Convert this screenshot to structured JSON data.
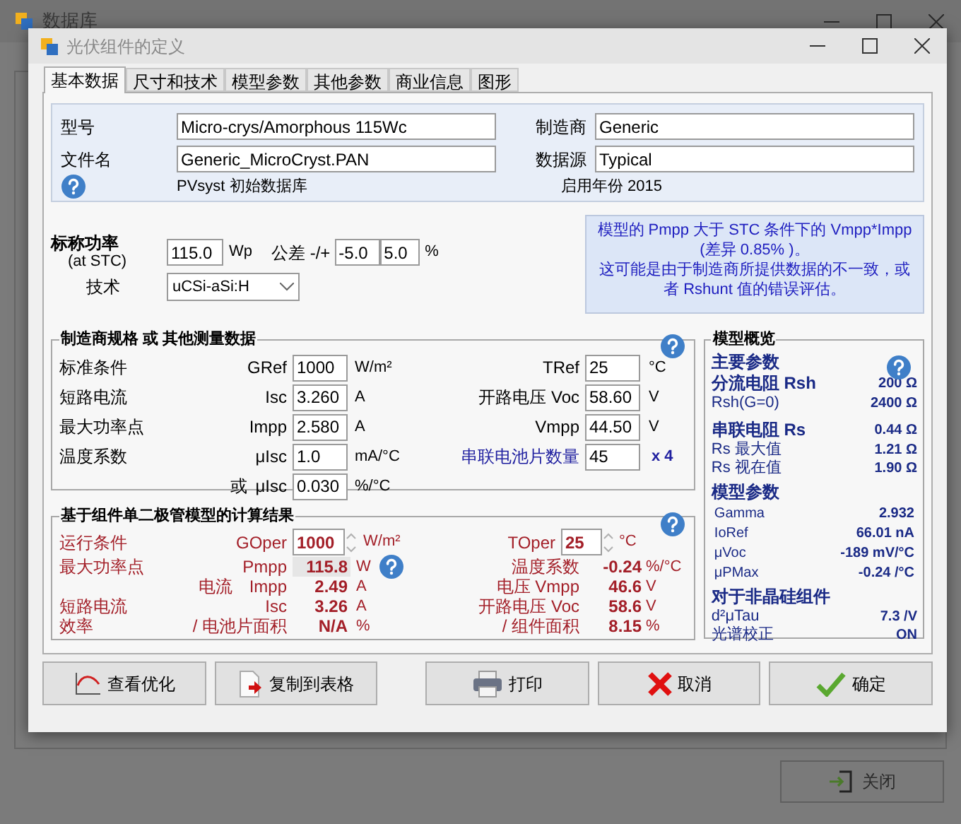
{
  "background_window": {
    "title": "数据库",
    "close_button": "关闭"
  },
  "dialog": {
    "title": "光伏组件的定义"
  },
  "tabs": [
    {
      "label": "基本数据",
      "selected": true
    },
    {
      "label": "尺寸和技术",
      "selected": false
    },
    {
      "label": "模型参数",
      "selected": false
    },
    {
      "label": "其他参数",
      "selected": false
    },
    {
      "label": "商业信息",
      "selected": false
    },
    {
      "label": "图形",
      "selected": false
    }
  ],
  "identity": {
    "left_fields": [
      {
        "label": "型号",
        "value": "Micro-crys/Amorphous 115Wc"
      },
      {
        "label": "文件名",
        "value": "Generic_MicroCryst.PAN"
      }
    ],
    "right_fields": [
      {
        "label": "制造商",
        "value": "Generic"
      },
      {
        "label": "数据源",
        "value": "Typical"
      }
    ],
    "source": "PVsyst 初始数据库",
    "year": "启用年份 2015"
  },
  "nominal": {
    "label": "标称功率",
    "sublabel": "(at STC)",
    "value": "115.0",
    "unit": "Wp",
    "tolerance_label": "公差 -/+",
    "tolerance_minus": "-5.0",
    "tolerance_plus": "5.0",
    "tolerance_unit": "%",
    "technology_label": "技术",
    "technology": "uCSi-aSi:H"
  },
  "warning": [
    "模型的 Pmpp 大于 STC 条件下的 Vmpp*Impp (差异 0.85% )。",
    "这可能是由于制造商所提供数据的不一致，或者 Rshunt 值的错误评估。"
  ],
  "specs": {
    "title": "制造商规格 或 其他测量数据",
    "rows": [
      {
        "label": "标准条件",
        "left": {
          "name": "GRef",
          "value": "1000",
          "unit": "W/m²"
        },
        "right": {
          "kind": "measure",
          "name": "TRef",
          "value": "25",
          "unit": "°C"
        }
      },
      {
        "label": "短路电流",
        "left": {
          "name": "Isc",
          "value": "3.260",
          "unit": "A"
        },
        "right": {
          "kind": "measure",
          "name": "开路电压 Voc",
          "value": "58.60",
          "unit": "V"
        }
      },
      {
        "label": "最大功率点",
        "left": {
          "name": "Impp",
          "value": "2.580",
          "unit": "A"
        },
        "right": {
          "kind": "measure",
          "name": "Vmpp",
          "value": "44.50",
          "unit": "V"
        }
      },
      {
        "label": "温度系数",
        "left": {
          "name": "μIsc",
          "value": "1.0",
          "unit": "mA/°C"
        },
        "right": {
          "kind": "count",
          "name": "串联电池片数量",
          "value": "45",
          "unit": "x 4"
        }
      },
      {
        "prefix": "或",
        "left": {
          "name": "μIsc",
          "value": "0.030",
          "unit": "%/°C"
        }
      }
    ]
  },
  "results": {
    "title": "基于组件单二极管模型的计算结果",
    "conditions": {
      "label": "运行条件",
      "left": {
        "name": "GOper",
        "value": "1000",
        "unit": "W/m²"
      },
      "right": {
        "name": "TOper",
        "value": "25",
        "unit": "°C"
      }
    },
    "rows": [
      {
        "label": "最大功率点",
        "left": {
          "name": "Pmpp",
          "value": "115.8",
          "unit": "W"
        },
        "right": {
          "name": "温度系数",
          "value": "-0.24",
          "unit": "%/°C"
        }
      },
      {
        "sublabel": "电流",
        "left": {
          "name": "Impp",
          "value": "2.49",
          "unit": "A"
        },
        "right": {
          "name": "电压 Vmpp",
          "value": "46.6",
          "unit": "V"
        }
      },
      {
        "label": "短路电流",
        "left": {
          "name": "Isc",
          "value": "3.26",
          "unit": "A"
        },
        "right": {
          "name": "开路电压 Voc",
          "value": "58.6",
          "unit": "V"
        }
      },
      {
        "label": "效率",
        "left": {
          "name": "/ 电池片面积",
          "value": "N/A",
          "unit": "%"
        },
        "right": {
          "name": "/ 组件面积",
          "value": "8.15",
          "unit": "%"
        }
      }
    ]
  },
  "overview": {
    "title": "模型概览",
    "items": [
      {
        "kind": "heading",
        "name": "主要参数"
      },
      {
        "kind": "main",
        "name": "分流电阻 Rsh",
        "value": "200 Ω"
      },
      {
        "kind": "sub",
        "name": "Rsh(G=0)",
        "value": "2400 Ω"
      },
      {
        "kind": "main",
        "name": "串联电阻 Rs",
        "value": "0.44 Ω"
      },
      {
        "kind": "sub",
        "name": "Rs 最大值",
        "value": "1.21 Ω"
      },
      {
        "kind": "sub",
        "name": "Rs 视在值",
        "value": "1.90 Ω"
      },
      {
        "kind": "heading",
        "name": "模型参数"
      },
      {
        "kind": "param",
        "name": "Gamma",
        "value": "2.932"
      },
      {
        "kind": "param",
        "name": "IoRef",
        "value": "66.01 nA"
      },
      {
        "kind": "param",
        "name": "μVoc",
        "value": "-189 mV/°C"
      },
      {
        "kind": "param",
        "name": "μPMax",
        "value": "-0.24 /°C"
      },
      {
        "kind": "heading",
        "name": "对于非晶硅组件"
      },
      {
        "kind": "sub",
        "name": "d²μTau",
        "value": "7.3 /V"
      },
      {
        "kind": "sub",
        "name": "光谱校正",
        "value": "ON"
      }
    ]
  },
  "buttons": [
    "查看优化",
    "复制到表格",
    "打印",
    "取消",
    "确定"
  ]
}
